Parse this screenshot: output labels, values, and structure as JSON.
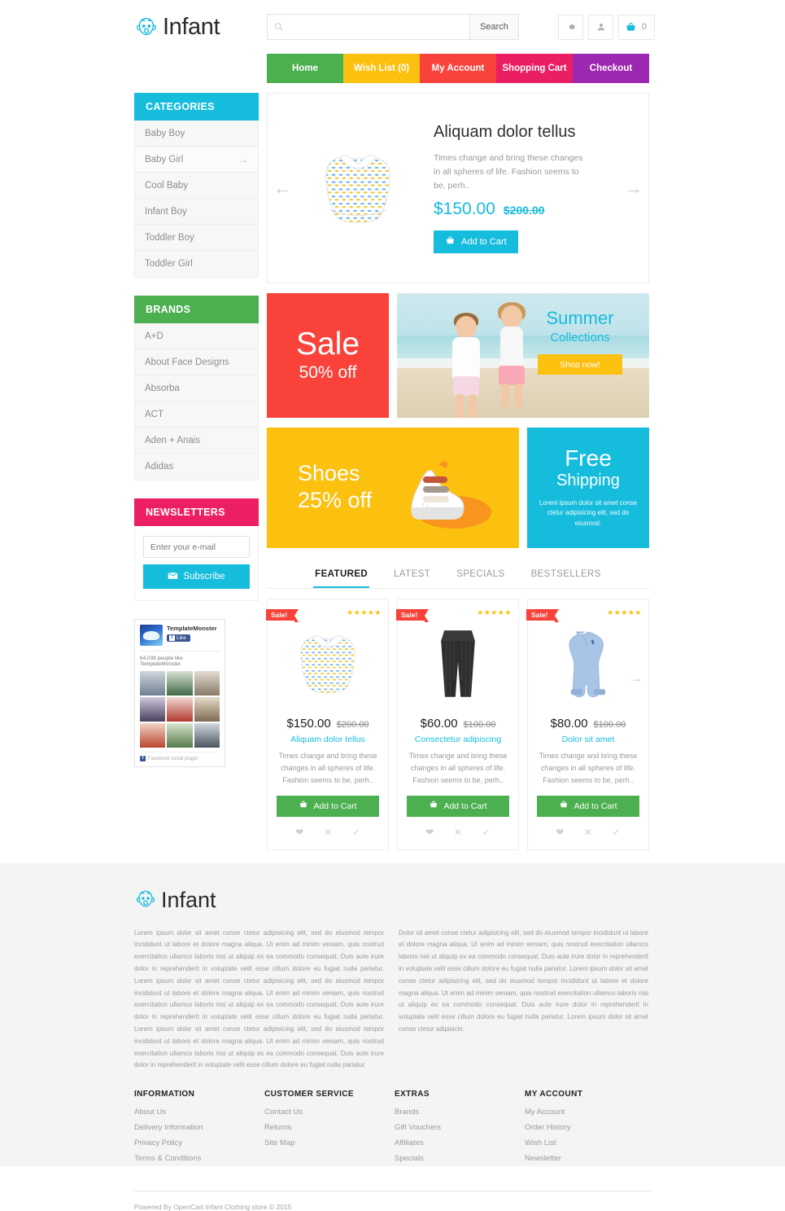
{
  "brand": {
    "name": "Infant",
    "logo_icon": "baby-face-icon"
  },
  "search": {
    "placeholder": "",
    "value": "",
    "button_label": "Search",
    "icon": "search-icon"
  },
  "header_icons": [
    {
      "name": "settings",
      "icon": "gear-icon"
    },
    {
      "name": "account",
      "icon": "user-icon"
    },
    {
      "name": "cart",
      "icon": "cart-icon",
      "count": "0"
    }
  ],
  "nav": [
    {
      "label": "Home",
      "color": "#4caf50"
    },
    {
      "label": "Wish List (0)",
      "color": "#fcc00f"
    },
    {
      "label": "My Account",
      "color": "#f9423a"
    },
    {
      "label": "Shopping Cart",
      "color": "#e91e63"
    },
    {
      "label": "Checkout",
      "color": "#9c27b0"
    }
  ],
  "sidebar": {
    "categories": {
      "title": "CATEGORIES",
      "color": "#16bcdc",
      "items": [
        {
          "label": "Baby Boy",
          "arrow": ""
        },
        {
          "label": "Baby Girl",
          "arrow": "→"
        },
        {
          "label": "Cool Baby",
          "arrow": ""
        },
        {
          "label": "Infant Boy",
          "arrow": ""
        },
        {
          "label": "Toddler Boy",
          "arrow": ""
        },
        {
          "label": "Toddler Girl",
          "arrow": ""
        }
      ]
    },
    "brands": {
      "title": "BRANDS",
      "color": "#4caf50",
      "items": [
        {
          "label": "A+D"
        },
        {
          "label": "About Face Designs"
        },
        {
          "label": "Absorba"
        },
        {
          "label": "ACT"
        },
        {
          "label": "Aden + Anais"
        },
        {
          "label": "Adidas"
        }
      ]
    },
    "newsletters": {
      "title": "NEWSLETTERS",
      "color": "#ec1f63",
      "placeholder": "Enter your e-mail",
      "value": "",
      "button_label": "Subscribe"
    },
    "facebook": {
      "page_name": "TemplateMonster",
      "like_label": "Like",
      "count_text": "64,038 people like TemplateMonster.",
      "footer_text": "Facebook social plugin",
      "avatars": [
        "#6e7f93",
        "#3f6a46",
        "#8a7a68",
        "#4a4060",
        "#b33a2e",
        "#7d6a52",
        "#b8452f",
        "#567a4a",
        "#4a5561"
      ]
    }
  },
  "carousel": {
    "title": "Aliquam dolor tellus",
    "description": "Times change and bring these changes in all spheres of life. Fashion seems to be, perh..",
    "price_new": "$150.00",
    "price_old": "$200.00",
    "button_label": "Add to Cart",
    "prev_icon": "arrow-left-icon",
    "next_icon": "arrow-right-icon"
  },
  "banners": {
    "sale": {
      "line1": "Sale",
      "line2": "50% off",
      "color": "#f9423a"
    },
    "summer": {
      "line1": "Summer",
      "line2": "Collections",
      "button_label": "Shop now!"
    },
    "shoes": {
      "line1": "Shoes",
      "line2": "25% off",
      "color": "#fcc00f"
    },
    "free_shipping": {
      "line1": "Free",
      "line2": "Shipping",
      "text": "Lorem ipsum dolor sit amet conse ctetur adipisicing elit, sed do eiusmod.",
      "color": "#16bcdc"
    }
  },
  "product_tabs": [
    {
      "label": "FEATURED",
      "active": true
    },
    {
      "label": "LATEST",
      "active": false
    },
    {
      "label": "SPECIALS",
      "active": false
    },
    {
      "label": "BESTSELLERS",
      "active": false
    }
  ],
  "products": [
    {
      "badge": "Sale!",
      "stars": "★★★★★",
      "price_new": "$150.00",
      "price_old": "$200.00",
      "name": "Aliquam dolor tellus",
      "description": "Times change and bring these changes in all spheres of life. Fashion seems to be, perh..",
      "button_label": "Add to Cart",
      "image": "cloth-diaper"
    },
    {
      "badge": "Sale!",
      "stars": "★★★★★",
      "price_new": "$60.00",
      "price_old": "$100.00",
      "name": "Consectetur adipiscing",
      "description": "Times change and bring these changes in all spheres of life. Fashion seems to be, perh..",
      "button_label": "Add to Cart",
      "image": "black-leggings"
    },
    {
      "badge": "Sale!",
      "stars": "★★★★★",
      "price_new": "$80.00",
      "price_old": "$100.00",
      "name": "Dolor sit amet",
      "description": "Times change and bring these changes in all spheres of life. Fashion seems to be, perh..",
      "button_label": "Add to Cart",
      "image": "blue-sleep-sack"
    }
  ],
  "footer": {
    "logo_text": "Infant",
    "text_col1": "Lorem ipsum dolor sit amet conse ctetur adipisicing elit, sed do eiusmod tempor incididunt ut labore et dolore magna aliqua. Ut enim ad minim veniam, quis nostrud exercitation ullamco laboris nisi ut aliquip ex ea commodo consequat. Duis aute irure dolor in reprehenderit in voluptate velit esse cillum dolore eu fugiat nulla pariatur. Lorem ipsum dolor sit amet conse ctetur adipisicing elit, sed do eiusmod tempor incididunt ut labore et dolore magna aliqua. Ut enim ad minim veniam, quis nostrud exercitation ullamco laboris nisi ut aliquip ex ea commodo consequat. Duis aute irure dolor in reprehenderit in voluptate velit esse cillum dolore eu fugiat nulla pariatur. Lorem ipsum dolor sit amet conse ctetur adipisicing elit, sed do eiusmod tempor incididunt ut labore et dolore magna aliqua. Ut enim ad minim veniam, quis nostrud exercitation ullamco laboris nisi ut aliquip ex ea commodo consequat. Duis aute irure dolor in reprehenderit in voluptate velit esse cillum dolore eu fugiat nulla pariatur.",
    "text_col2": "Dolor sit amet conse ctetur adipisicing elit, sed do eiusmod tempor incididunt ut labore et dolore magna aliqua. Ut enim ad minim veniam, quis nostrud exercitation ullamco laboris nisi ut aliquip ex ea commodo consequat. Duis aute irure dolor in reprehenderit in voluptate velit esse cillum dolore eu fugiat nulla pariatur. Lorem ipsum dolor sit amet conse ctetur adipisicing elit, sed do eiusmod tempor incididunt ut labore et dolore magna aliqua. Ut enim ad minim veniam, quis nostrud exercitation ullamco laboris nisi ut aliquip ex ea commodo consequat. Duis aute irure dolor in reprehenderit in voluptate velit esse cillum dolore eu fugiat nulla pariatur. Lorem ipsum dolor sit amet conse ctetur adipisicin.",
    "columns": [
      {
        "heading": "INFORMATION",
        "links": [
          "About Us",
          "Delivery Information",
          "Privacy Policy",
          "Terms & Conditions"
        ]
      },
      {
        "heading": "CUSTOMER SERVICE",
        "links": [
          "Contact Us",
          "Returns",
          "Site Map"
        ]
      },
      {
        "heading": "EXTRAS",
        "links": [
          "Brands",
          "Gift Vouchers",
          "Affiliates",
          "Specials"
        ]
      },
      {
        "heading": "MY ACCOUNT",
        "links": [
          "My Account",
          "Order History",
          "Wish List",
          "Newsletter"
        ]
      }
    ],
    "copyright": "Powered By OpenCart Infant Clothing store © 2015"
  }
}
